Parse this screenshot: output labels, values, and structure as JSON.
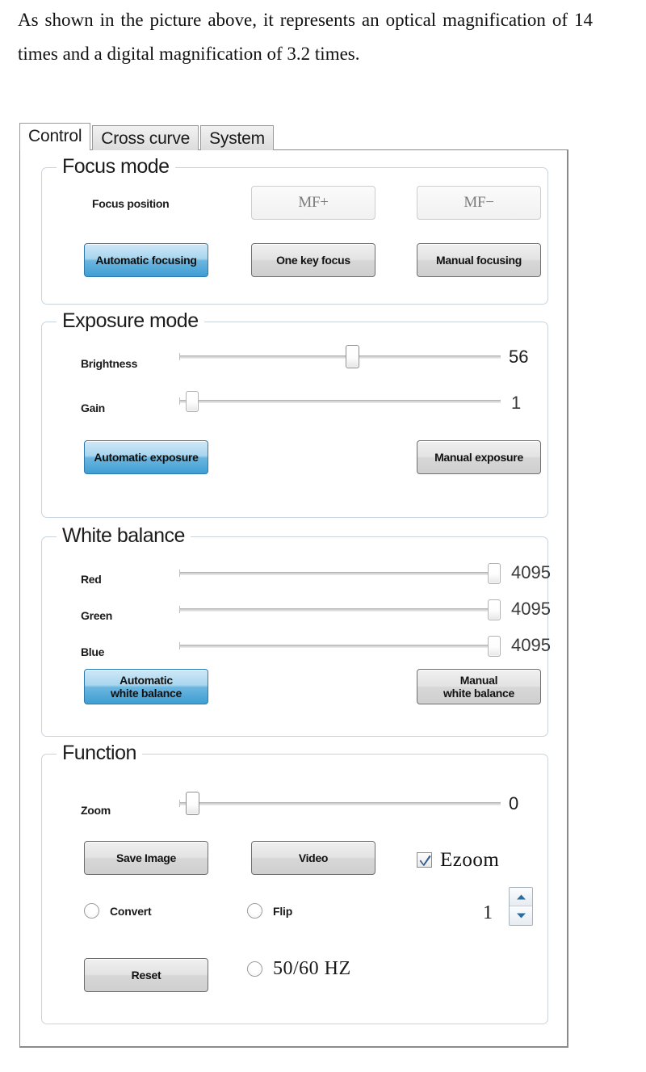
{
  "document": {
    "paragraph": "As shown in the picture above, it represents an optical magnification of 14 times and a digital magnification of 3.2 times."
  },
  "tabs": [
    {
      "label": "Control",
      "active": true
    },
    {
      "label": "Cross curve",
      "active": false
    },
    {
      "label": "System",
      "active": false
    }
  ],
  "focus_mode": {
    "title": "Focus mode",
    "focus_position_label": "Focus position",
    "mf_plus_label": "MF+",
    "mf_minus_label": "MF−",
    "automatic_focusing_label": "Automatic focusing",
    "one_key_focus_label": "One key focus",
    "manual_focusing_label": "Manual focusing",
    "selected": "Automatic focusing"
  },
  "exposure_mode": {
    "title": "Exposure mode",
    "brightness_label": "Brightness",
    "brightness_value": "56",
    "brightness_percent": 54,
    "gain_label": "Gain",
    "gain_value": "1",
    "gain_percent": 2,
    "automatic_exposure_label": "Automatic exposure",
    "manual_exposure_label": "Manual exposure",
    "selected": "Automatic exposure"
  },
  "white_balance": {
    "title": "White balance",
    "red_label": "Red",
    "red_value": "4095",
    "red_percent": 100,
    "green_label": "Green",
    "green_value": "4095",
    "green_percent": 100,
    "blue_label": "Blue",
    "blue_value": "4095",
    "blue_percent": 100,
    "automatic_white_balance_label": "Automatic\nwhite balance",
    "manual_white_balance_label": "Manual\nwhite balance",
    "selected": "Automatic white balance"
  },
  "function": {
    "title": "Function",
    "zoom_label": "Zoom",
    "zoom_value": "0",
    "zoom_percent": 2,
    "save_image_label": "Save Image",
    "video_label": "Video",
    "ezoom_label": "Ezoom",
    "ezoom_checked": true,
    "convert_label": "Convert",
    "convert_checked": false,
    "flip_label": "Flip",
    "flip_checked": false,
    "spinner_value": "1",
    "reset_label": "Reset",
    "frequency_label": "50/60 HZ",
    "frequency_checked": false
  },
  "colors": {
    "accent_blue": "#3f9ed3",
    "checkbox_check": "#2f5f93",
    "group_border": "#c9d4de",
    "panel_border": "#8d8d8d",
    "button_face": "#e3e3e3"
  }
}
